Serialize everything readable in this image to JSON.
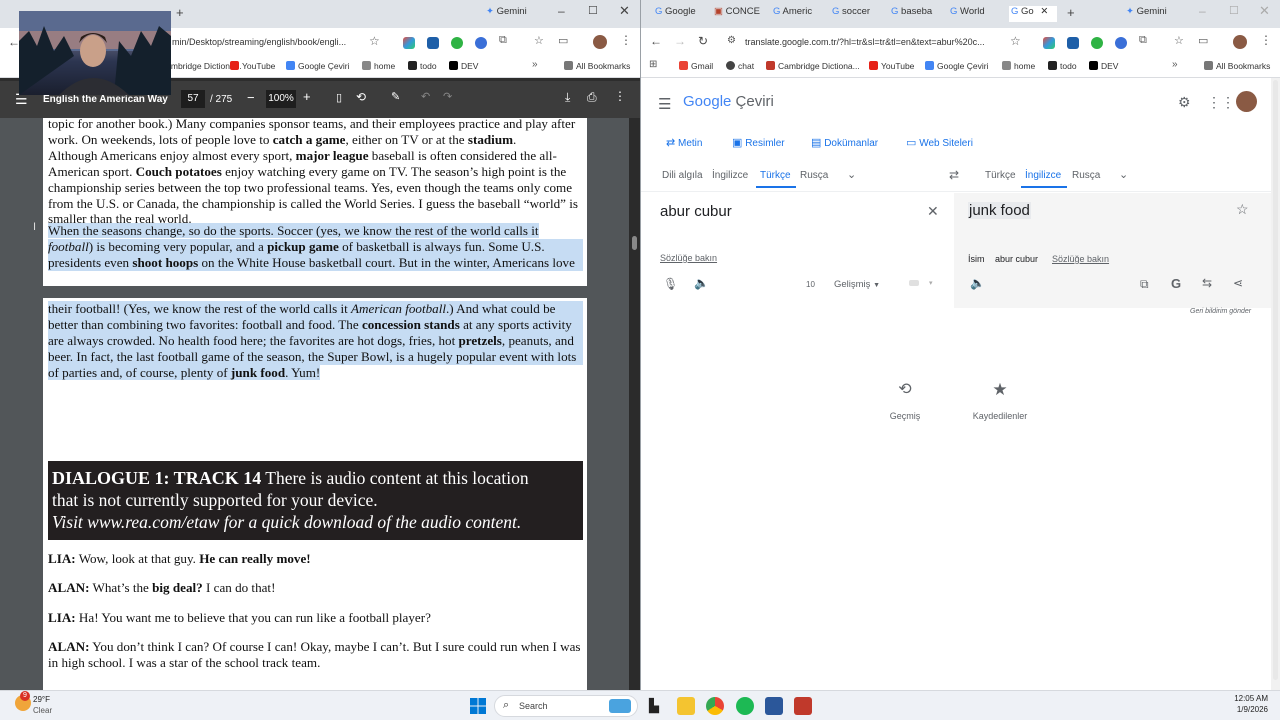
{
  "left_window": {
    "tabs": [
      {
        "label": "Gemini"
      }
    ],
    "address": "min/Desktop/streaming/english/book/engli...",
    "bookmarks": [
      {
        "label": "Cambridge Dictiona...",
        "color": "#c0392b"
      },
      {
        "label": "YouTube",
        "color": "#e62117"
      },
      {
        "label": "Google Çeviri",
        "color": "#4285f4"
      },
      {
        "label": "home",
        "color": "#5f6368"
      },
      {
        "label": "todo",
        "color": "#222222"
      },
      {
        "label": "DEV",
        "color": "#000000"
      }
    ],
    "all_bookmarks": "All Bookmarks",
    "pdf": {
      "title": "English the American Way",
      "page_current": "57",
      "page_total": "/ 275",
      "zoom": "100%"
    },
    "page1": {
      "l1": "topic for another book.) Many companies sponsor teams, and their employees practice and play after",
      "l2a": "work. On weekends, lots of people love to ",
      "l2b": "catch a game",
      "l2c": ", either on TV or at the ",
      "l2d": "stadium",
      "l2e": ".",
      "l3a": "  Although Americans enjoy almost every sport, ",
      "l3b": "major league",
      "l3c": " baseball is often considered the all-",
      "l4a": "American sport. ",
      "l4b": "Couch potatoes",
      "l4c": " enjoy watching every game on TV. The season’s high point is the",
      "l5": "championship series between the top two professional teams. Yes, even though the teams only come",
      "l6": "from the U.S. or Canada, the championship is called the World Series. I guess the baseball “world” is",
      "l7": "smaller than the real world.",
      "h1": "  When the seasons change, so do the sports. Soccer (yes, we know the rest of the world calls it",
      "h2a": "football",
      "h2b": ") is becoming very popular, and a ",
      "h2c": "pickup game",
      "h2d": " of basketball is always fun. Some U.S.",
      "h3a": "presidents even ",
      "h3b": "shoot hoops",
      "h3c": " on the White House basketball court. But in the winter, Americans love"
    },
    "page2": {
      "h1a": "their football! (Yes, we know the rest of the world calls it ",
      "h1b": "American football",
      "h1c": ".) And what could be",
      "h2a": "better than combining two favorites: football and food. The ",
      "h2b": "concession stands",
      "h2c": " at any sports activity",
      "h3a": "are always crowded. No health food here; the favorites are hot dogs, fries, hot ",
      "h3b": "pretzels",
      "h3c": ", peanuts, and",
      "h4": "beer. In fact, the last football game of the season, the Super Bowl, is a hugely popular event with lots",
      "h5a": "of parties and, of course, plenty of ",
      "h5b": "junk food",
      "h5c": ". Yum!",
      "track_title": "DIALOGUE 1: TRACK 14",
      "track_msg1": " There is audio content at this location",
      "track_msg2": "that is not currently supported for your device.",
      "track_msg3": "Visit www.rea.com/etaw for a quick download of the audio content.",
      "d1_speaker": "LIA:",
      "d1_text": " Wow, look at that guy. ",
      "d1_bold": "He can really move!",
      "d2_speaker": "ALAN:",
      "d2_text": " What’s the ",
      "d2_bold": "big deal?",
      "d2_rest": " I can do that!",
      "d3_speaker": "LIA:",
      "d3_text": " Ha! You want me to believe that you can run like a football player?",
      "d4_speaker": "ALAN:",
      "d4_text": " You don’t think I can? Of course I can! Okay, maybe I can’t. But I sure could run when I was",
      "d4_text2": "in high school. I was a star of the school track team."
    }
  },
  "right_window": {
    "tabs": [
      {
        "label": "Google"
      },
      {
        "label": "CONCE"
      },
      {
        "label": "Americ"
      },
      {
        "label": "soccer"
      },
      {
        "label": "baseba"
      },
      {
        "label": "World"
      },
      {
        "label": "Go"
      },
      {
        "label": "Gemini"
      }
    ],
    "address": "translate.google.com.tr/?hl=tr&sl=tr&tl=en&text=abur%20c...",
    "bookmarks": [
      {
        "label": "Gmail"
      },
      {
        "label": "chat"
      },
      {
        "label": "Cambridge Dictiona..."
      },
      {
        "label": "YouTube"
      },
      {
        "label": "Google Çeviri"
      },
      {
        "label": "home"
      },
      {
        "label": "todo"
      },
      {
        "label": "DEV"
      }
    ],
    "all_bookmarks": "All Bookmarks",
    "translate": {
      "logo_google": "Google",
      "logo_ceviri": "Çeviri",
      "tools": [
        "Metin",
        "Resimler",
        "Dokümanlar",
        "Web Siteleri"
      ],
      "source_langs": [
        "Dili algıla",
        "İngilizce",
        "Türkçe",
        "Rusça"
      ],
      "target_langs": [
        "Türkçe",
        "İngilizce",
        "Rusça"
      ],
      "source_text": "abur cubur",
      "target_text": "junk food",
      "dict_link": "Sözlüğe bakın",
      "char_count": "10",
      "advanced": "Gelişmiş",
      "pos_label": "İsim",
      "pos_word": "abur cubur",
      "pos_link": "Sözlüğe bakın",
      "feedback": "Geri bildirim gönder",
      "history": "Geçmiş",
      "saved": "Kaydedilenler"
    }
  },
  "taskbar": {
    "temp": "29°F",
    "weather": "Clear",
    "weather_badge": "9",
    "search": "Search",
    "time": "12:05 AM",
    "date": "1/9/2026"
  }
}
